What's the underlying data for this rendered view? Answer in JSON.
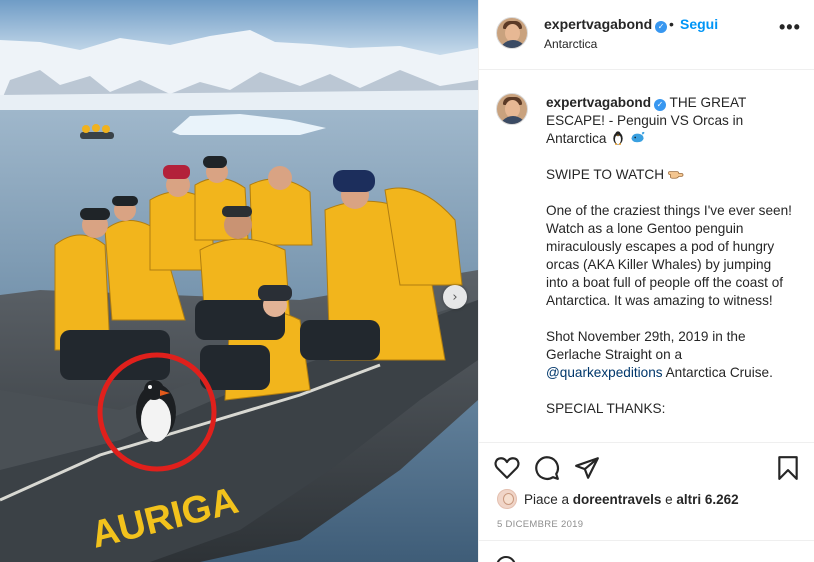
{
  "post": {
    "photo_alt": "",
    "next_arrow": "›",
    "boat_name": "AURIGA"
  },
  "header": {
    "username": "expertvagabond",
    "verified_glyph": "✓",
    "separator": "•",
    "follow_label": "Segui",
    "location": "Antarctica",
    "more_glyph": "•••"
  },
  "caption": {
    "username": "expertvagabond",
    "line1": "THE GREAT ESCAPE! - Penguin VS Orcas in Antarctica",
    "emojis1": [
      "penguin",
      "whale"
    ],
    "line2": "SWIPE TO WATCH",
    "emoji2": "pointing-hand",
    "line3": "One of the craziest things I've ever seen! Watch as a lone Gentoo penguin miraculously escapes a pod of hungry orcas (AKA Killer Whales) by jumping into a boat full of people off the coast of Antarctica. It was amazing to witness!",
    "line4a": "Shot November 29th, 2019 in the Gerlache Straight on a",
    "mention": "@quarkexpeditions",
    "line4b": "Antarctica Cruise.",
    "line5": "SPECIAL THANKS:"
  },
  "actions": {
    "like_icon": "heart-icon",
    "comment_icon": "comment-icon",
    "share_icon": "share-icon",
    "save_icon": "bookmark-icon",
    "likes_prefix": "Piace a",
    "likes_user": "doreentravels",
    "likes_mid": "e",
    "likes_count": "altri 6.262",
    "date": "5 DICEMBRE 2019"
  },
  "colors": {
    "accent": "#0095f6",
    "verified": "#3897f0",
    "text": "#262626",
    "muted": "#8e8e8e",
    "border": "#efefef",
    "jacket": "#f2b51c",
    "highlight_circle": "#e0201c"
  }
}
